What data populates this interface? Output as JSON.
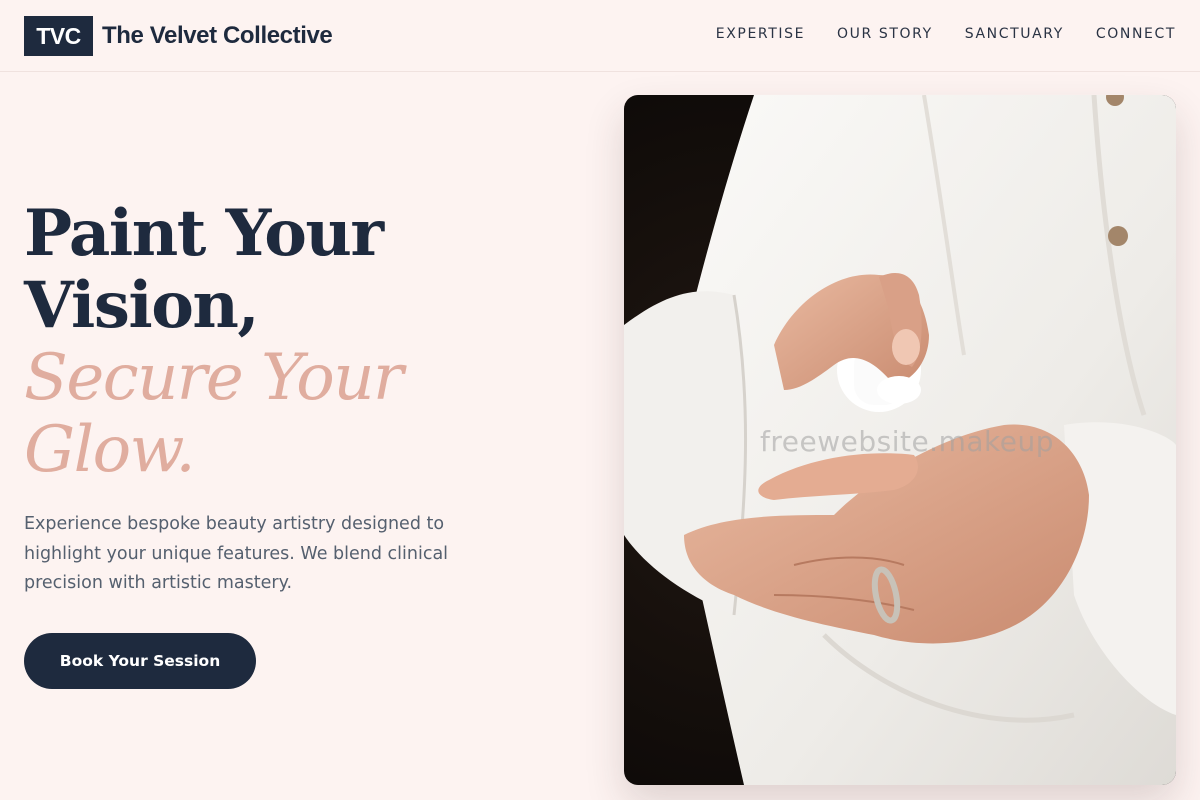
{
  "brand": {
    "mark": "TVC",
    "name": "The Velvet Collective"
  },
  "nav": {
    "items": [
      {
        "label": "EXPERTISE"
      },
      {
        "label": "OUR STORY"
      },
      {
        "label": "SANCTUARY"
      },
      {
        "label": "CONNECT"
      }
    ]
  },
  "hero": {
    "headline_line1": "Paint Your",
    "headline_line2": "Vision,",
    "accent_line1": "Secure Your",
    "accent_line2": "Glow.",
    "description": "Experience bespoke beauty artistry designed to highlight your unique features. We blend clinical precision with artistic mastery.",
    "cta_label": "Book Your Session",
    "image_watermark": "freewebsite.makeup"
  },
  "colors": {
    "background": "#fdf3f1",
    "primary_navy": "#1e2a3e",
    "accent_rose": "#e0ad9f",
    "body_text": "#55606f"
  }
}
